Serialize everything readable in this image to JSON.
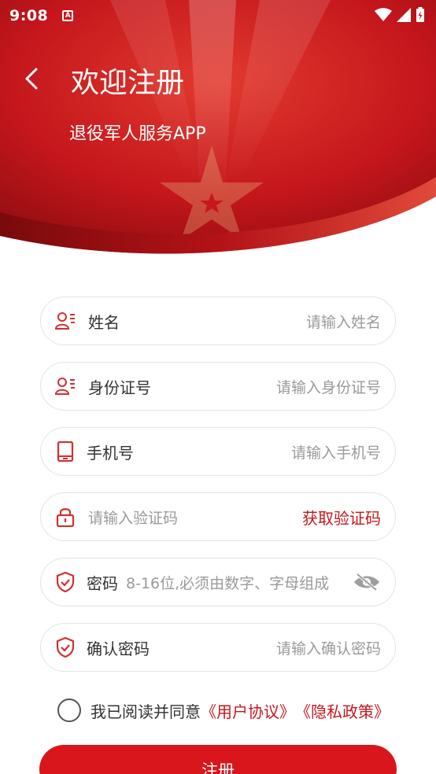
{
  "status_bar": {
    "time": "9:08",
    "notification_icon": "A"
  },
  "header": {
    "title": "欢迎注册",
    "subtitle": "退役军人服务APP"
  },
  "form": {
    "name": {
      "label": "姓名",
      "placeholder": "请输入姓名"
    },
    "id_number": {
      "label": "身份证号",
      "placeholder": "请输入身份证号"
    },
    "phone": {
      "label": "手机号",
      "placeholder": "请输入手机号"
    },
    "verify_code": {
      "placeholder": "请输入验证码",
      "action": "获取验证码"
    },
    "password": {
      "label": "密码",
      "placeholder": "8-16位,必须由数字、字母组成"
    },
    "confirm_password": {
      "label": "确认密码",
      "placeholder": "请输入确认密码"
    }
  },
  "agreement": {
    "text": "我已阅读并同意",
    "user_agreement": "《用户协议》",
    "privacy_policy": "《隐私政策》"
  },
  "submit_label": "注册",
  "colors": {
    "brand_red": "#c8161d",
    "button_red": "#d9161c",
    "icon_red": "#d32f2f"
  }
}
